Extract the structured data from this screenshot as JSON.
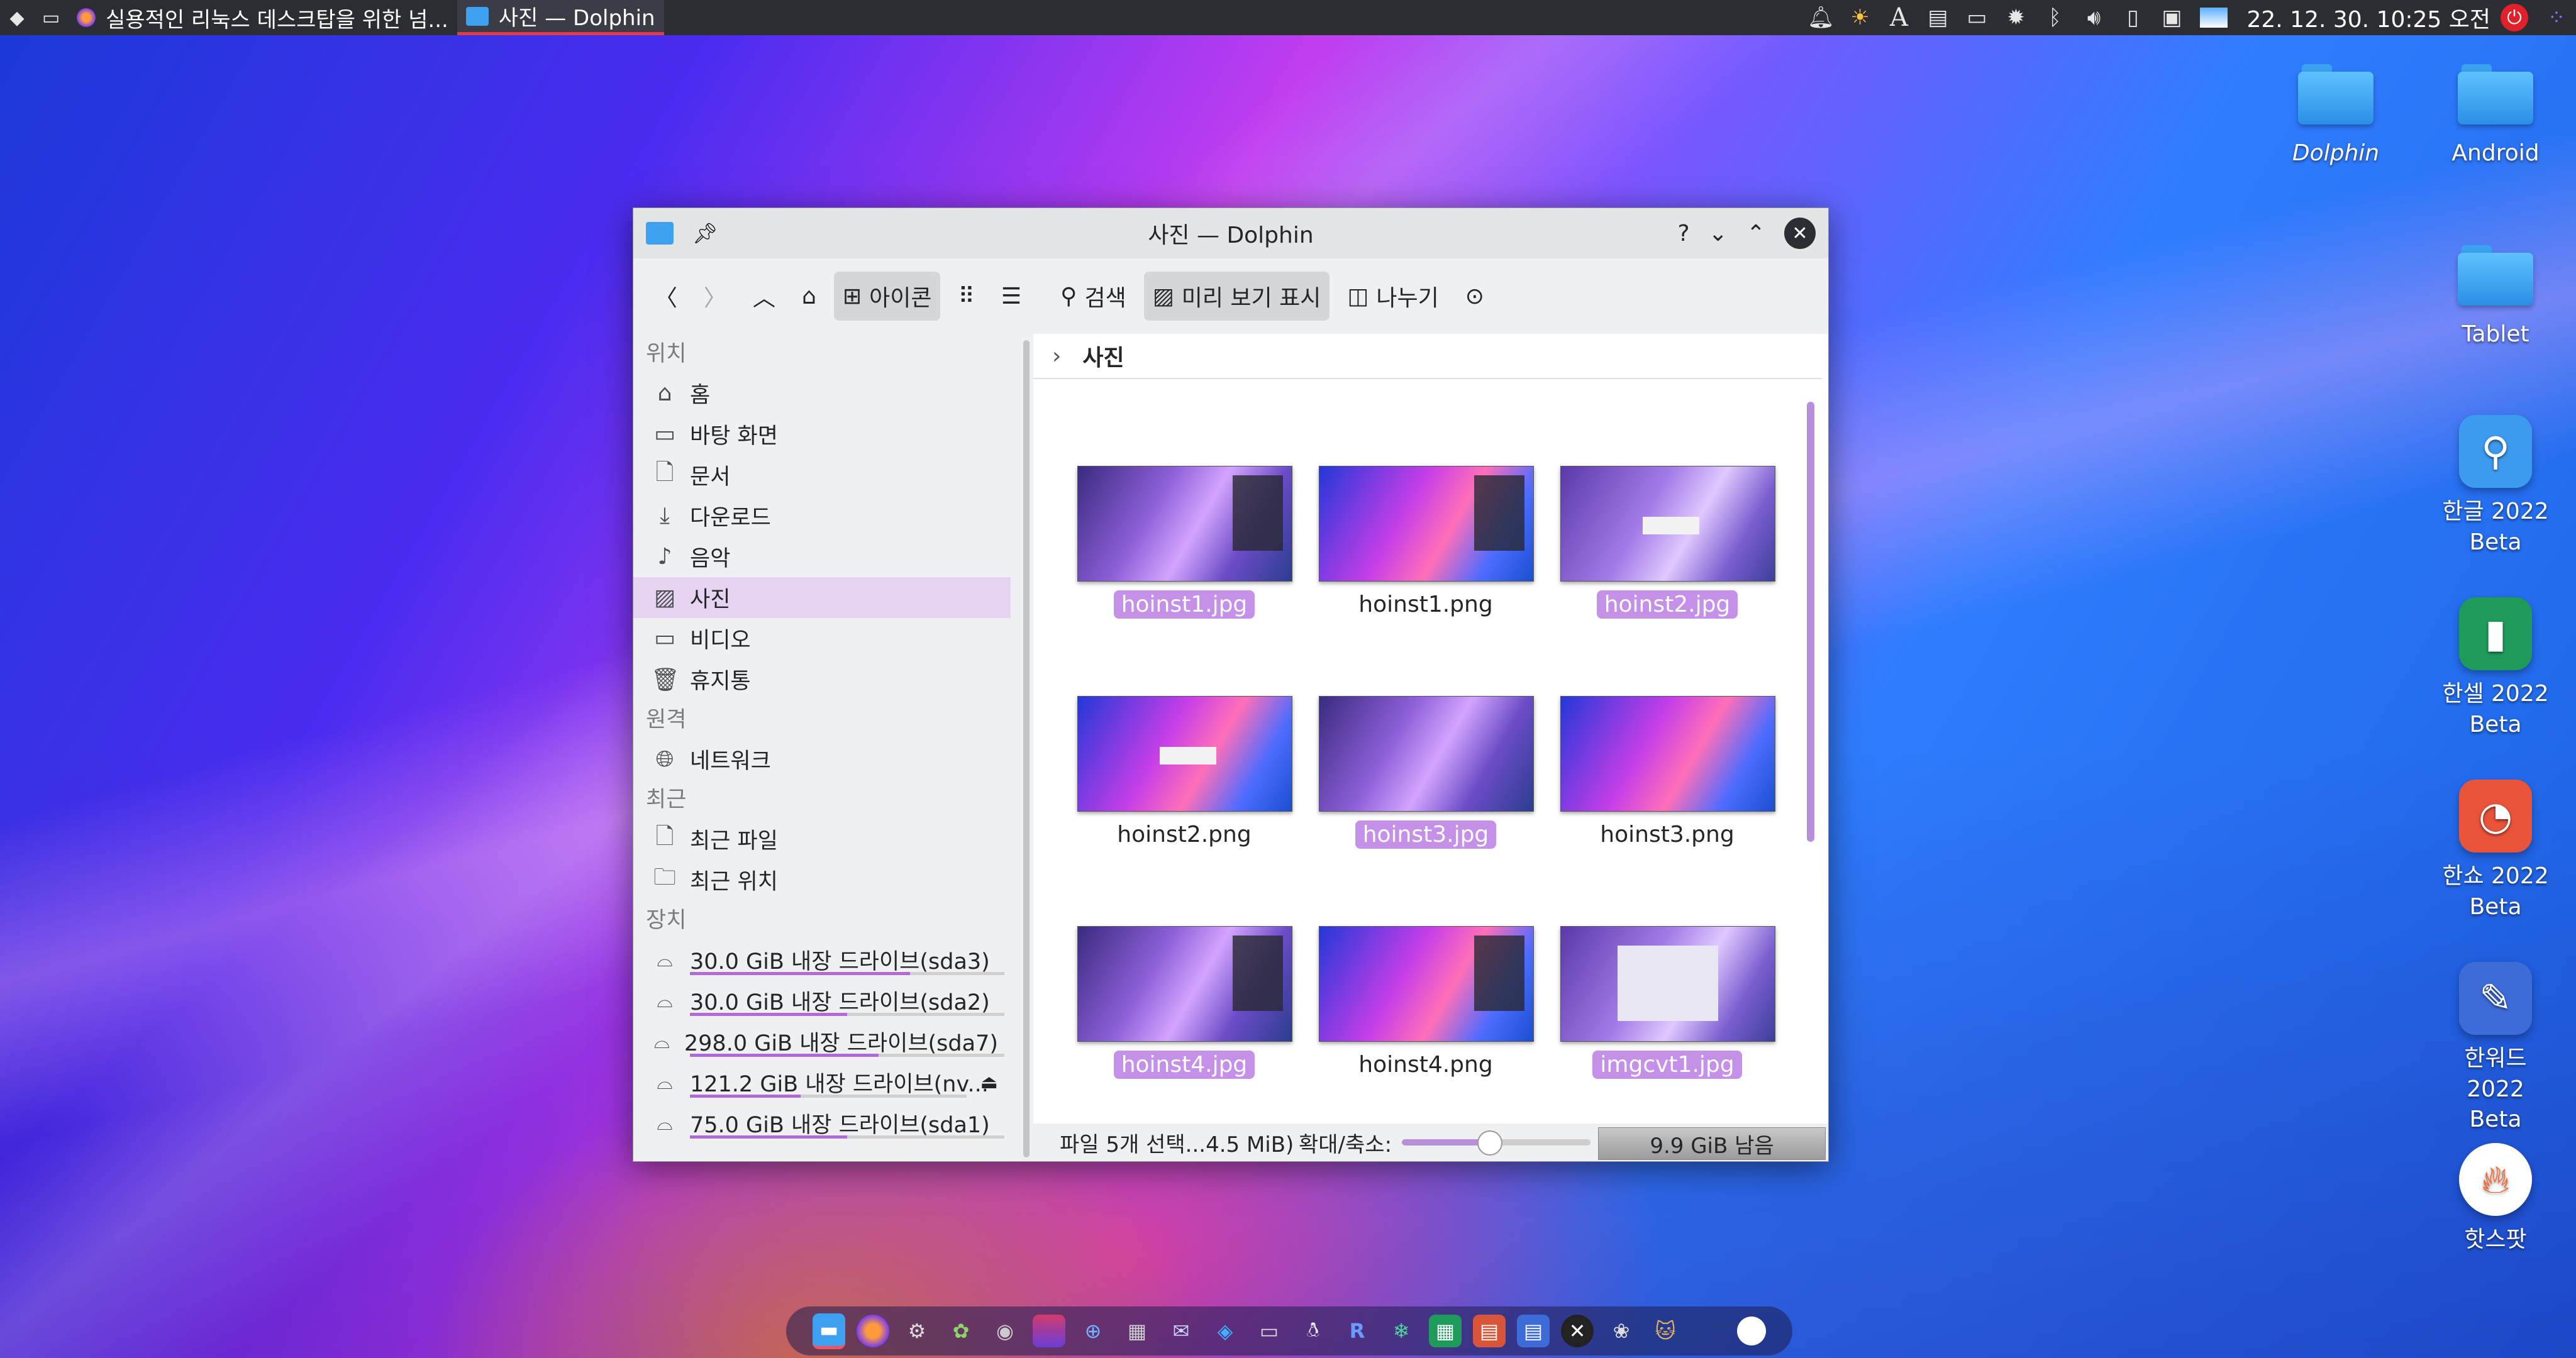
{
  "top_panel": {
    "tasks": [
      {
        "title": "실용적인 리눅스 데스크탑을 위한 넘...",
        "icon": "firefox-icon"
      },
      {
        "title": "사진 — Dolphin",
        "icon": "folder-icon"
      }
    ],
    "clock": "22. 12. 30.  10:25 오전"
  },
  "desktop_icons": [
    {
      "label": "Dolphin"
    },
    {
      "label": "Android"
    },
    {
      "label": "Tablet"
    },
    {
      "label": "한글 2022 Beta"
    },
    {
      "label": "한셀 2022 Beta"
    },
    {
      "label": "한쇼 2022 Beta"
    },
    {
      "label": "한워드 2022 Beta"
    },
    {
      "label": "핫스팟"
    }
  ],
  "window": {
    "title": "사진 — Dolphin",
    "toolbar": {
      "icons_view": "아이콘",
      "search": "검색",
      "preview": "미리 보기 표시",
      "split": "나누기"
    },
    "sidebar": {
      "sections": {
        "places": "위치",
        "remote": "원격",
        "recent": "최근",
        "devices": "장치"
      },
      "places": [
        "홈",
        "바탕 화면",
        "문서",
        "다운로드",
        "음악",
        "사진",
        "비디오",
        "휴지통"
      ],
      "remote": [
        "네트워크"
      ],
      "recent": [
        "최근 파일",
        "최근 위치"
      ],
      "devices": [
        {
          "label": "30.0 GiB 내장 드라이브(sda3)",
          "used": 0.7
        },
        {
          "label": "30.0 GiB 내장 드라이브(sda2)",
          "used": 0.5
        },
        {
          "label": "298.0 GiB 내장 드라이브(sda7)",
          "used": 0.6
        },
        {
          "label": "121.2 GiB 내장 드라이브(nv...",
          "used": 0.4
        },
        {
          "label": "75.0 GiB 내장 드라이브(sda1)",
          "used": 0.5
        }
      ]
    },
    "breadcrumb": "사진",
    "files": [
      {
        "name": "hoinst1.jpg",
        "selected": true
      },
      {
        "name": "hoinst1.png",
        "selected": false
      },
      {
        "name": "hoinst2.jpg",
        "selected": true
      },
      {
        "name": "hoinst2.png",
        "selected": false
      },
      {
        "name": "hoinst3.jpg",
        "selected": true
      },
      {
        "name": "hoinst3.png",
        "selected": false
      },
      {
        "name": "hoinst4.jpg",
        "selected": true
      },
      {
        "name": "hoinst4.png",
        "selected": false
      },
      {
        "name": "imgcvt1.jpg",
        "selected": true
      }
    ],
    "status": {
      "selection": "파일 5개 선택...4.5 MiB)",
      "zoom_label": "확대/축소:",
      "zoom_level": 0.46,
      "free_space": "9.9 GiB 남음"
    }
  }
}
